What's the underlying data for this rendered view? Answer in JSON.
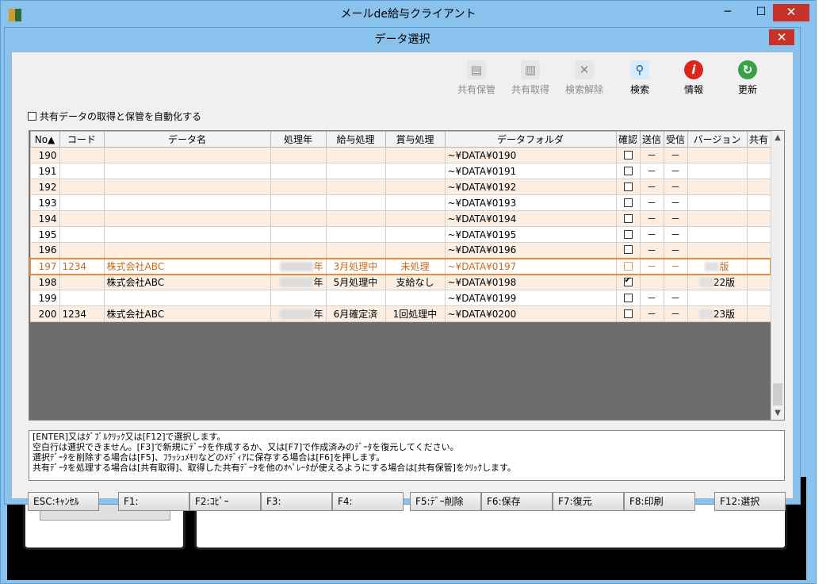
{
  "main_window": {
    "title": "メールde給与クライアント",
    "controls": {
      "minimize": "─",
      "maximize": "☐",
      "close": "✕"
    }
  },
  "dialog": {
    "title": "データ選択",
    "close": "✕"
  },
  "auto_share_label": "共有データの取得と保管を自動化する",
  "toolbar": [
    {
      "label": "共有保管",
      "icon": "share-store-icon",
      "glyph": "▤",
      "enabled": false
    },
    {
      "label": "共有取得",
      "icon": "share-get-icon",
      "glyph": "▥",
      "enabled": false
    },
    {
      "label": "検索解除",
      "icon": "search-clear-icon",
      "glyph": "✕",
      "enabled": false
    },
    {
      "label": "検索",
      "icon": "search-icon",
      "glyph": "⚲",
      "enabled": true
    },
    {
      "label": "情報",
      "icon": "info-icon",
      "glyph": "i",
      "enabled": true
    },
    {
      "label": "更新",
      "icon": "refresh-icon",
      "glyph": "↻",
      "enabled": true
    }
  ],
  "table": {
    "headers": [
      "No▲",
      "コード",
      "データ名",
      "処理年",
      "給与処理",
      "賞与処理",
      "データフォルダ",
      "確認",
      "送信",
      "受信",
      "バージョン",
      "共有"
    ],
    "rows": [
      {
        "no": "190",
        "code": "",
        "name": "",
        "year": "",
        "salary": "",
        "bonus": "",
        "folder": "~¥DATA¥0190",
        "check": false,
        "send": "－",
        "recv": "－",
        "version": "",
        "shared": ""
      },
      {
        "no": "191",
        "code": "",
        "name": "",
        "year": "",
        "salary": "",
        "bonus": "",
        "folder": "~¥DATA¥0191",
        "check": false,
        "send": "－",
        "recv": "－",
        "version": "",
        "shared": ""
      },
      {
        "no": "192",
        "code": "",
        "name": "",
        "year": "",
        "salary": "",
        "bonus": "",
        "folder": "~¥DATA¥0192",
        "check": false,
        "send": "－",
        "recv": "－",
        "version": "",
        "shared": ""
      },
      {
        "no": "193",
        "code": "",
        "name": "",
        "year": "",
        "salary": "",
        "bonus": "",
        "folder": "~¥DATA¥0193",
        "check": false,
        "send": "－",
        "recv": "－",
        "version": "",
        "shared": ""
      },
      {
        "no": "194",
        "code": "",
        "name": "",
        "year": "",
        "salary": "",
        "bonus": "",
        "folder": "~¥DATA¥0194",
        "check": false,
        "send": "－",
        "recv": "－",
        "version": "",
        "shared": ""
      },
      {
        "no": "195",
        "code": "",
        "name": "",
        "year": "",
        "salary": "",
        "bonus": "",
        "folder": "~¥DATA¥0195",
        "check": false,
        "send": "－",
        "recv": "－",
        "version": "",
        "shared": ""
      },
      {
        "no": "196",
        "code": "",
        "name": "",
        "year": "",
        "salary": "",
        "bonus": "",
        "folder": "~¥DATA¥0196",
        "check": false,
        "send": "－",
        "recv": "－",
        "version": "",
        "shared": ""
      },
      {
        "no": "197",
        "code": "1234",
        "name": "株式会社ABC",
        "year": "年",
        "salary": "3月処理中",
        "bonus": "未処理",
        "folder": "~¥DATA¥0197",
        "check": false,
        "send": "－",
        "recv": "－",
        "version": "版",
        "shared": "",
        "selected": true
      },
      {
        "no": "198",
        "code": "",
        "name": "株式会社ABC",
        "year": "年",
        "salary": "5月処理中",
        "bonus": "支給なし",
        "folder": "~¥DATA¥0198",
        "check": true,
        "send": "",
        "recv": "",
        "version": "22版",
        "shared": ""
      },
      {
        "no": "199",
        "code": "",
        "name": "",
        "year": "",
        "salary": "",
        "bonus": "",
        "folder": "~¥DATA¥0199",
        "check": false,
        "send": "－",
        "recv": "－",
        "version": "",
        "shared": ""
      },
      {
        "no": "200",
        "code": "1234",
        "name": "株式会社ABC",
        "year": "年",
        "salary": "6月確定済",
        "bonus": "1回処理中",
        "folder": "~¥DATA¥0200",
        "check": false,
        "send": "－",
        "recv": "－",
        "version": "23版",
        "shared": ""
      }
    ]
  },
  "hints": [
    "[ENTER]又はﾀﾞﾌﾞﾙｸﾘｯｸ又は[F12]で選択します。",
    "空白行は選択できません。[F3]で新規にﾃﾞｰﾀを作成するか、又は[F7]で作成済みのﾃﾞｰﾀを復元してください。",
    "選択ﾃﾞｰﾀを削除する場合は[F5]、ﾌﾗｯｼｭﾒﾓﾘなどのﾒﾃﾞｨｱに保存する場合は[F6]を押します。",
    "共有ﾃﾞｰﾀを処理する場合は[共有取得]、取得した共有ﾃﾞｰﾀを他のｵﾍﾟﾚｰﾀが使えるようにする場合は[共有保管]をｸﾘｯｸします。"
  ],
  "fkeys": [
    {
      "key": "esc",
      "label": "ESC:ｷｬﾝｾﾙ"
    },
    {
      "key": "f1",
      "label": "F1:"
    },
    {
      "key": "f2",
      "label": "F2:ｺﾋﾟｰ"
    },
    {
      "key": "f3",
      "label": "F3:"
    },
    {
      "key": "f4",
      "label": "F4:"
    },
    {
      "key": "f5",
      "label": "F5:ﾃﾞｰ削除"
    },
    {
      "key": "f6",
      "label": "F6:保存"
    },
    {
      "key": "f7",
      "label": "F7:復元"
    },
    {
      "key": "f8",
      "label": "F8:印刷"
    },
    {
      "key": "f12",
      "label": "F12:選択"
    }
  ],
  "colors": {
    "title_bar": "#8ac2ee",
    "close_button": "#c7332a",
    "row_odd": "#fdeee1",
    "selected_text": "#c66a1e",
    "selected_border": "#e98b3d",
    "grid_empty": "#6d6d6d"
  }
}
